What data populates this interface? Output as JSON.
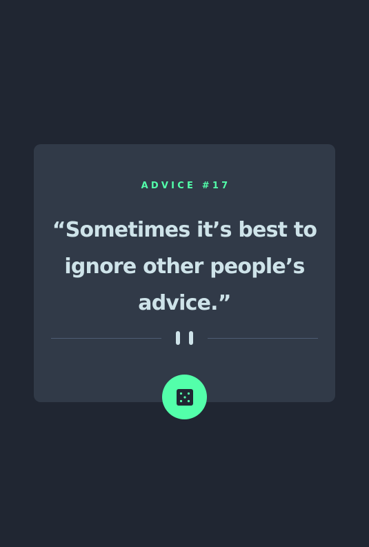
{
  "advice": {
    "label": "ADVICE #17",
    "quote": "“Sometimes it’s best to ignore other people’s advice.”"
  },
  "divider": {
    "icon": "pause-icon"
  },
  "dice_button": {
    "icon": "dice-icon"
  },
  "colors": {
    "background": "#202632",
    "card": "#313a48",
    "accent": "#53ffaa",
    "text": "#cee3e9",
    "divider": "#4f5d74"
  }
}
